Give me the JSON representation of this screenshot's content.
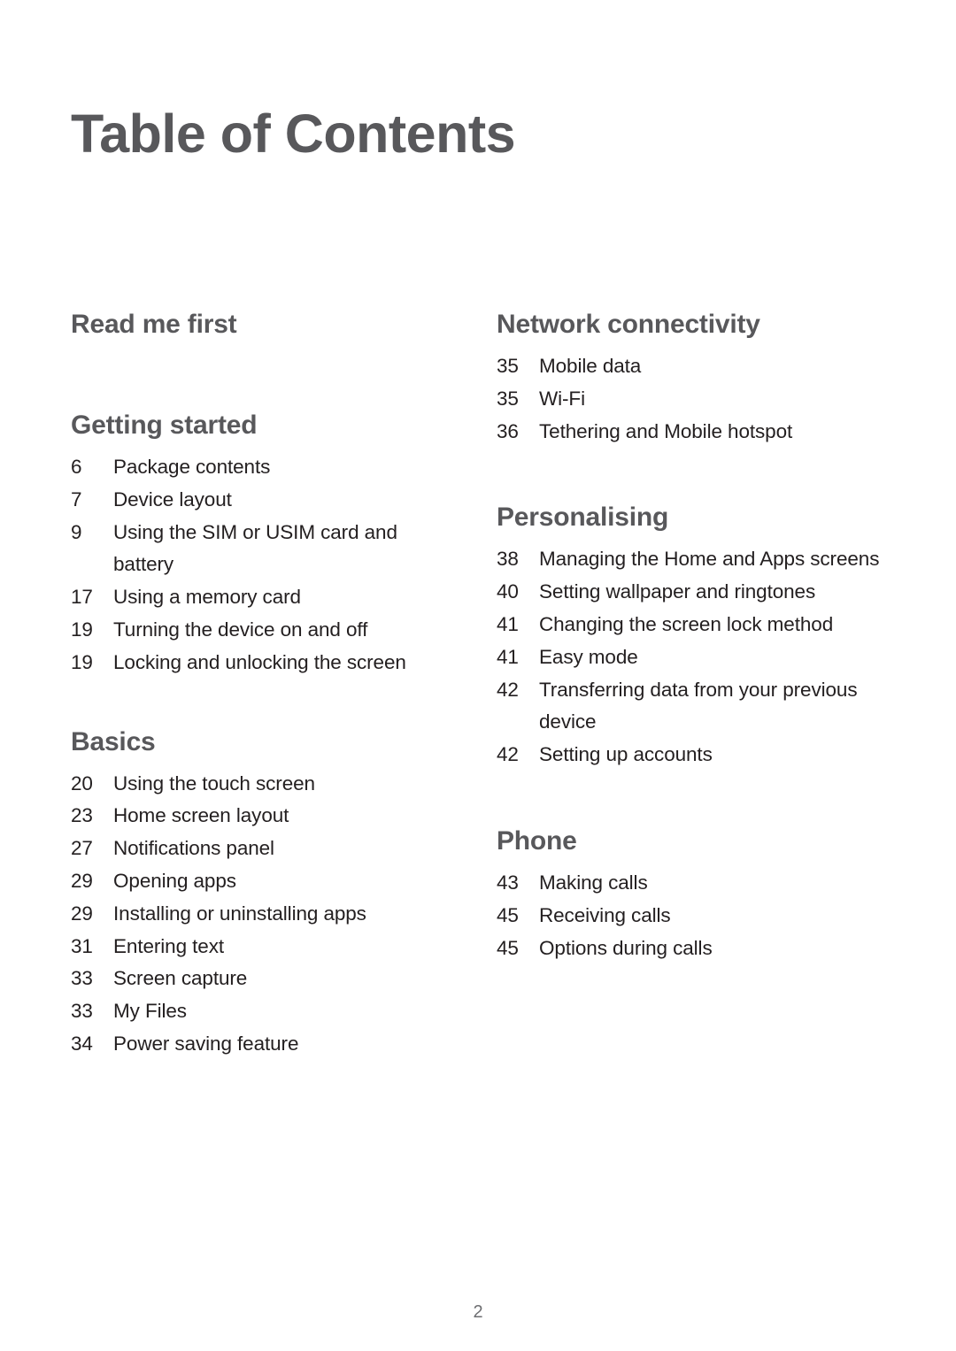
{
  "document": {
    "title": "Table of Contents",
    "page_number": "2",
    "colors": {
      "heading": "#58585B",
      "entry_text": "#231F20",
      "page_number": "#6D6E71",
      "background": "#FFFFFF"
    }
  },
  "columns": {
    "left": [
      {
        "heading": "Read me first",
        "entries": []
      },
      {
        "heading": "Getting started",
        "entries": [
          {
            "page": "6",
            "title": "Package contents"
          },
          {
            "page": "7",
            "title": "Device layout"
          },
          {
            "page": "9",
            "title": "Using the SIM or USIM card and battery"
          },
          {
            "page": "17",
            "title": "Using a memory card"
          },
          {
            "page": "19",
            "title": "Turning the device on and off"
          },
          {
            "page": "19",
            "title": "Locking and unlocking the screen"
          }
        ]
      },
      {
        "heading": "Basics",
        "entries": [
          {
            "page": "20",
            "title": "Using the touch screen"
          },
          {
            "page": "23",
            "title": "Home screen layout"
          },
          {
            "page": "27",
            "title": "Notifications panel"
          },
          {
            "page": "29",
            "title": "Opening apps"
          },
          {
            "page": "29",
            "title": "Installing or uninstalling apps"
          },
          {
            "page": "31",
            "title": "Entering text"
          },
          {
            "page": "33",
            "title": "Screen capture"
          },
          {
            "page": "33",
            "title": "My Files"
          },
          {
            "page": "34",
            "title": "Power saving feature"
          }
        ]
      }
    ],
    "right": [
      {
        "heading": "Network connectivity",
        "entries": [
          {
            "page": "35",
            "title": "Mobile data"
          },
          {
            "page": "35",
            "title": "Wi-Fi"
          },
          {
            "page": "36",
            "title": "Tethering and Mobile hotspot"
          }
        ]
      },
      {
        "heading": "Personalising",
        "entries": [
          {
            "page": "38",
            "title": "Managing the Home and Apps screens"
          },
          {
            "page": "40",
            "title": "Setting wallpaper and ringtones"
          },
          {
            "page": "41",
            "title": "Changing the screen lock method"
          },
          {
            "page": "41",
            "title": "Easy mode"
          },
          {
            "page": "42",
            "title": "Transferring data from your previous device"
          },
          {
            "page": "42",
            "title": "Setting up accounts"
          }
        ]
      },
      {
        "heading": "Phone",
        "entries": [
          {
            "page": "43",
            "title": "Making calls"
          },
          {
            "page": "45",
            "title": "Receiving calls"
          },
          {
            "page": "45",
            "title": "Options during calls"
          }
        ]
      }
    ]
  }
}
